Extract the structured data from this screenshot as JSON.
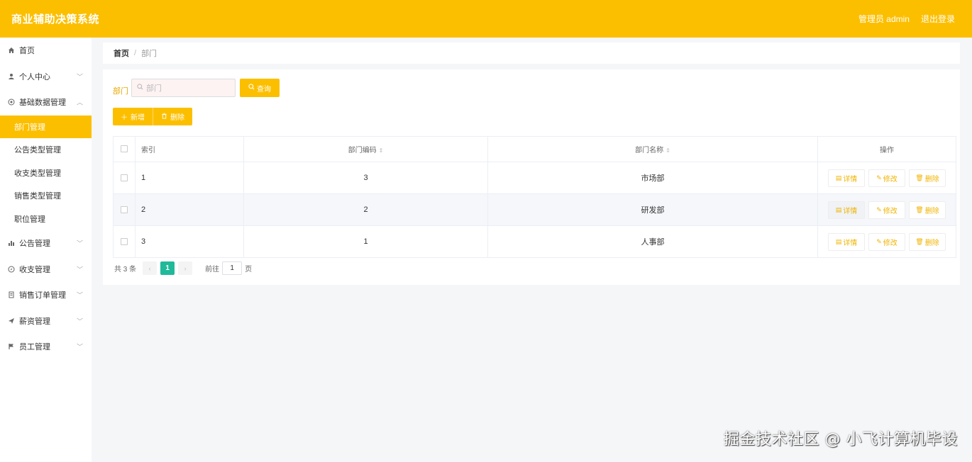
{
  "header": {
    "title": "商业辅助决策系统",
    "user": "管理员 admin",
    "logout": "退出登录",
    "bg_color": "#fcbf00"
  },
  "sidebar": {
    "items": [
      {
        "label": "首页",
        "icon": "home-icon"
      },
      {
        "label": "个人中心",
        "icon": "user-icon"
      },
      {
        "label": "基础数据管理",
        "icon": "circle-icon"
      },
      {
        "label": "公告管理",
        "icon": "bar-chart-icon"
      },
      {
        "label": "收支管理",
        "icon": "compass-icon"
      },
      {
        "label": "销售订单管理",
        "icon": "document-icon"
      },
      {
        "label": "薪资管理",
        "icon": "send-icon"
      },
      {
        "label": "员工管理",
        "icon": "flag-icon"
      }
    ],
    "submenu": [
      {
        "label": "部门管理",
        "active": true
      },
      {
        "label": "公告类型管理"
      },
      {
        "label": "收支类型管理"
      },
      {
        "label": "销售类型管理"
      },
      {
        "label": "职位管理"
      }
    ]
  },
  "breadcrumb": {
    "home": "首页",
    "separator": "/",
    "current": "部门"
  },
  "search": {
    "label": "部门",
    "placeholder": "部门",
    "query_button": "查询"
  },
  "actions": {
    "add": "新增",
    "delete": "删除"
  },
  "table": {
    "headers": {
      "index": "索引",
      "code": "部门编码",
      "name": "部门名称",
      "ops": "操作"
    },
    "rows": [
      {
        "index": "1",
        "code": "3",
        "name": "市场部"
      },
      {
        "index": "2",
        "code": "2",
        "name": "研发部"
      },
      {
        "index": "3",
        "code": "1",
        "name": "人事部"
      }
    ],
    "row_actions": {
      "detail": "详情",
      "edit": "修改",
      "delete": "删除"
    }
  },
  "pagination": {
    "total": "共 3 条",
    "current_page": "1",
    "goto_label": "前往",
    "goto_value": "1",
    "page_suffix": "页",
    "active_color": "#20b99a"
  },
  "watermark": "掘金技术社区 @ 小飞计算机毕设"
}
